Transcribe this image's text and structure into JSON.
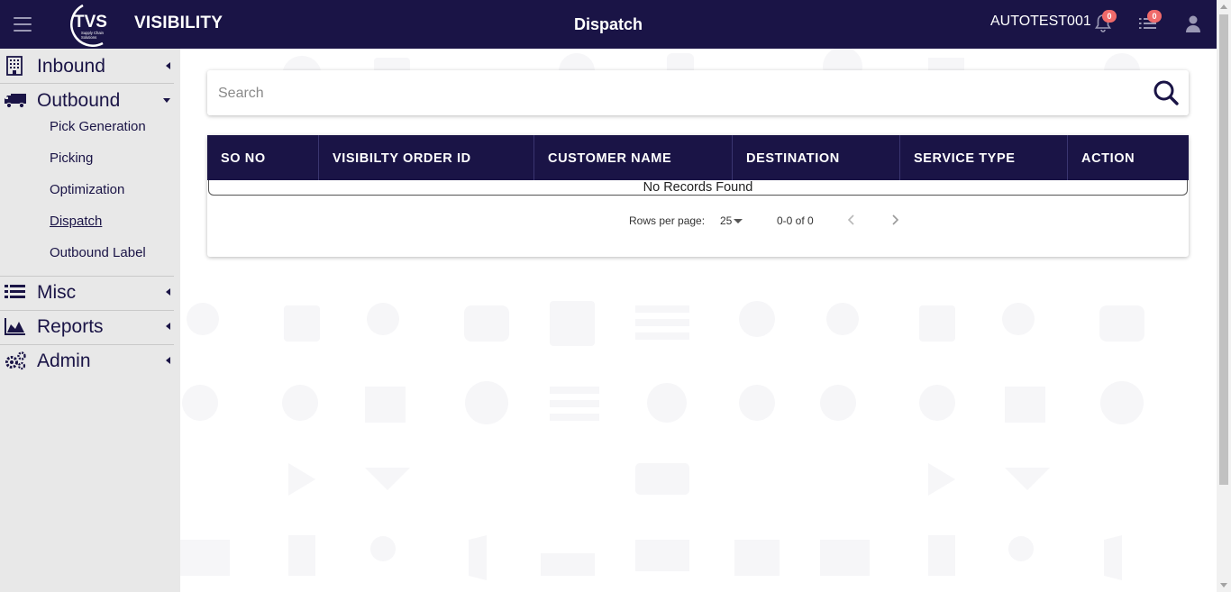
{
  "header": {
    "logo_text": "TVS",
    "logo_subtext": "Supply Chain Solutions",
    "brand": "VISIBILITY",
    "page_title": "Dispatch",
    "username": "AUTOTEST001",
    "notifications_count": "0",
    "tasks_count": "0"
  },
  "sidebar": {
    "sections": [
      {
        "label": "Inbound",
        "icon": "building-icon",
        "expanded": false
      },
      {
        "label": "Outbound",
        "icon": "truck-icon",
        "expanded": true
      },
      {
        "label": "Misc",
        "icon": "list-icon",
        "expanded": false
      },
      {
        "label": "Reports",
        "icon": "area-chart-icon",
        "expanded": false
      },
      {
        "label": "Admin",
        "icon": "cogs-icon",
        "expanded": false
      }
    ],
    "outbound_items": [
      {
        "label": "Pick Generation"
      },
      {
        "label": "Picking"
      },
      {
        "label": "Optimization"
      },
      {
        "label": "Dispatch",
        "active": true
      },
      {
        "label": "Outbound Label"
      }
    ]
  },
  "search": {
    "placeholder": "Search",
    "value": ""
  },
  "table": {
    "columns": [
      "SO NO",
      "VISIBILTY ORDER ID",
      "CUSTOMER NAME",
      "DESTINATION",
      "SERVICE TYPE",
      "ACTION"
    ],
    "rows": [],
    "empty_message": "No Records Found"
  },
  "pagination": {
    "rows_per_page_label": "Rows per page:",
    "rows_per_page": "25",
    "range": "0-0 of 0"
  },
  "colors": {
    "primary": "#1a1446",
    "sidebar_bg": "#e8e8e8",
    "badge": "#f06a6a"
  }
}
